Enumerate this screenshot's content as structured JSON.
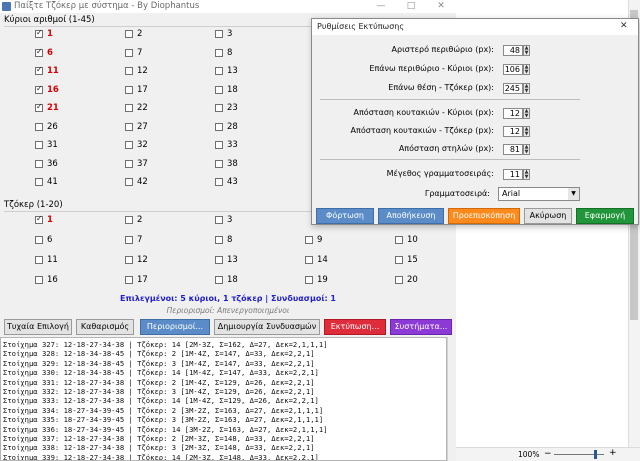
{
  "main_window": {
    "title": "Παίξτε Τζόκερ με σύστημα - By Diophantus",
    "minimize": "—",
    "maximize": "□",
    "close": "✕"
  },
  "main_numbers": {
    "title": "Κύριοι αριθμοί (1-45)",
    "columns": [
      [
        {
          "n": "1",
          "c": true
        },
        {
          "n": "6",
          "c": true
        },
        {
          "n": "11",
          "c": true
        },
        {
          "n": "16",
          "c": true
        },
        {
          "n": "21",
          "c": true
        },
        {
          "n": "26",
          "c": false
        },
        {
          "n": "31",
          "c": false
        },
        {
          "n": "36",
          "c": false
        },
        {
          "n": "41",
          "c": false
        }
      ],
      [
        {
          "n": "2",
          "c": false
        },
        {
          "n": "7",
          "c": false
        },
        {
          "n": "12",
          "c": false
        },
        {
          "n": "17",
          "c": false
        },
        {
          "n": "22",
          "c": false
        },
        {
          "n": "27",
          "c": false
        },
        {
          "n": "32",
          "c": false
        },
        {
          "n": "37",
          "c": false
        },
        {
          "n": "42",
          "c": false
        }
      ],
      [
        {
          "n": "3",
          "c": false
        },
        {
          "n": "8",
          "c": false
        },
        {
          "n": "13",
          "c": false
        },
        {
          "n": "18",
          "c": false
        },
        {
          "n": "23",
          "c": false
        },
        {
          "n": "28",
          "c": false
        },
        {
          "n": "33",
          "c": false
        },
        {
          "n": "38",
          "c": false
        },
        {
          "n": "43",
          "c": false
        }
      ]
    ]
  },
  "joker_numbers": {
    "title": "Τζόκερ (1-20)",
    "rows": [
      [
        {
          "n": "1",
          "c": true
        },
        {
          "n": "2",
          "c": false
        },
        {
          "n": "3",
          "c": false
        }
      ],
      [
        {
          "n": "6",
          "c": false
        },
        {
          "n": "7",
          "c": false
        },
        {
          "n": "8",
          "c": false
        },
        {
          "n": "9",
          "c": false
        },
        {
          "n": "10",
          "c": false
        }
      ],
      [
        {
          "n": "11",
          "c": false
        },
        {
          "n": "12",
          "c": false
        },
        {
          "n": "13",
          "c": false
        },
        {
          "n": "14",
          "c": false
        },
        {
          "n": "15",
          "c": false
        }
      ],
      [
        {
          "n": "16",
          "c": false
        },
        {
          "n": "17",
          "c": false
        },
        {
          "n": "18",
          "c": false
        },
        {
          "n": "19",
          "c": false
        },
        {
          "n": "20",
          "c": false
        }
      ]
    ]
  },
  "status": "Επιλεγμένοι: 5 κύριοι, 1 τζόκερ | Συνδυασμοί: 1",
  "restrictions_status": "Περιορισμοί: Απενεργοποιημένοι",
  "buttons": {
    "random": "Τυχαία Επιλογή",
    "clear": "Καθαρισμός",
    "restrictions": "Περιορισμοί...",
    "create": "Δημιουργία Συνδυασμών",
    "print": "Εκτύπωση...",
    "systems": "Συστήματα..."
  },
  "log_lines": [
    "Στοίχημα 327: 12-18-27-34-38 | Τζόκερ: 14 [2Μ-3Ζ, Σ=162, Δ=27, Δεκ=2,1,1,1]",
    "Στοίχημα 328: 12-18-34-38-45 | Τζόκερ: 2 [1Μ-4Ζ, Σ=147, Δ=33, Δεκ=2,2,1]",
    "Στοίχημα 329: 12-18-34-38-45 | Τζόκερ: 3 [1Μ-4Ζ, Σ=147, Δ=33, Δεκ=2,2,1]",
    "Στοίχημα 330: 12-18-34-38-45 | Τζόκερ: 14 [1Μ-4Ζ, Σ=147, Δ=33, Δεκ=2,2,1]",
    "Στοίχημα 331: 12-18-27-34-38 | Τζόκερ: 2 [1Μ-4Ζ, Σ=129, Δ=26, Δεκ=2,2,1]",
    "Στοίχημα 332: 12-18-27-34-38 | Τζόκερ: 3 [1Μ-4Ζ, Σ=129, Δ=26, Δεκ=2,2,1]",
    "Στοίχημα 333: 12-18-27-34-38 | Τζόκερ: 14 [1Μ-4Ζ, Σ=129, Δ=26, Δεκ=2,2,1]",
    "Στοίχημα 334: 18-27-34-39-45 | Τζόκερ: 2 [3Μ-2Ζ, Σ=163, Δ=27, Δεκ=2,1,1,1]",
    "Στοίχημα 335: 18-27-34-39-45 | Τζόκερ: 3 [3Μ-2Ζ, Σ=163, Δ=27, Δεκ=2,1,1,1]",
    "Στοίχημα 336: 18-27-34-39-45 | Τζόκερ: 14 [3Μ-2Ζ, Σ=163, Δ=27, Δεκ=2,1,1,1]",
    "Στοίχημα 337: 12-18-27-34-38 | Τζόκερ: 2 [2Μ-3Ζ, Σ=148, Δ=33, Δεκ=2,2,1]",
    "Στοίχημα 338: 12-18-27-34-38 | Τζόκερ: 3 [2Μ-3Ζ, Σ=148, Δ=33, Δεκ=2,2,1]",
    "Στοίχημα 339: 12-18-27-34-38 | Τζόκερ: 14 [2Μ-3Ζ, Σ=148, Δ=33, Δεκ=2,2,1]"
  ],
  "dialog": {
    "title": "Ρυθμίσεις Εκτύπωσης",
    "close": "✕",
    "fields": [
      {
        "label": "Αριστερό περιθώριο (px):",
        "value": "48"
      },
      {
        "label": "Επάνω περιθώριο - Κύριοι (px):",
        "value": "106"
      },
      {
        "label": "Επάνω θέση - Τζόκερ (px):",
        "value": "245"
      },
      {
        "label": "Απόσταση κουτακιών - Κύριοι (px):",
        "value": "12"
      },
      {
        "label": "Απόσταση κουτακιών - Τζόκερ (px):",
        "value": "12"
      },
      {
        "label": "Απόσταση στηλών (px):",
        "value": "81"
      },
      {
        "label": "Μέγεθος γραμματοσειράς:",
        "value": "11"
      }
    ],
    "font_label": "Γραμματοσειρά:",
    "font_value": "Arial",
    "buttons": {
      "photo": "Φόρτωση",
      "save": "Αποθήκευση",
      "preview": "Προεπισκόπηση",
      "cancel": "Ακύρωση",
      "apply": "Εφαρμογή"
    }
  },
  "zoom": "100%"
}
